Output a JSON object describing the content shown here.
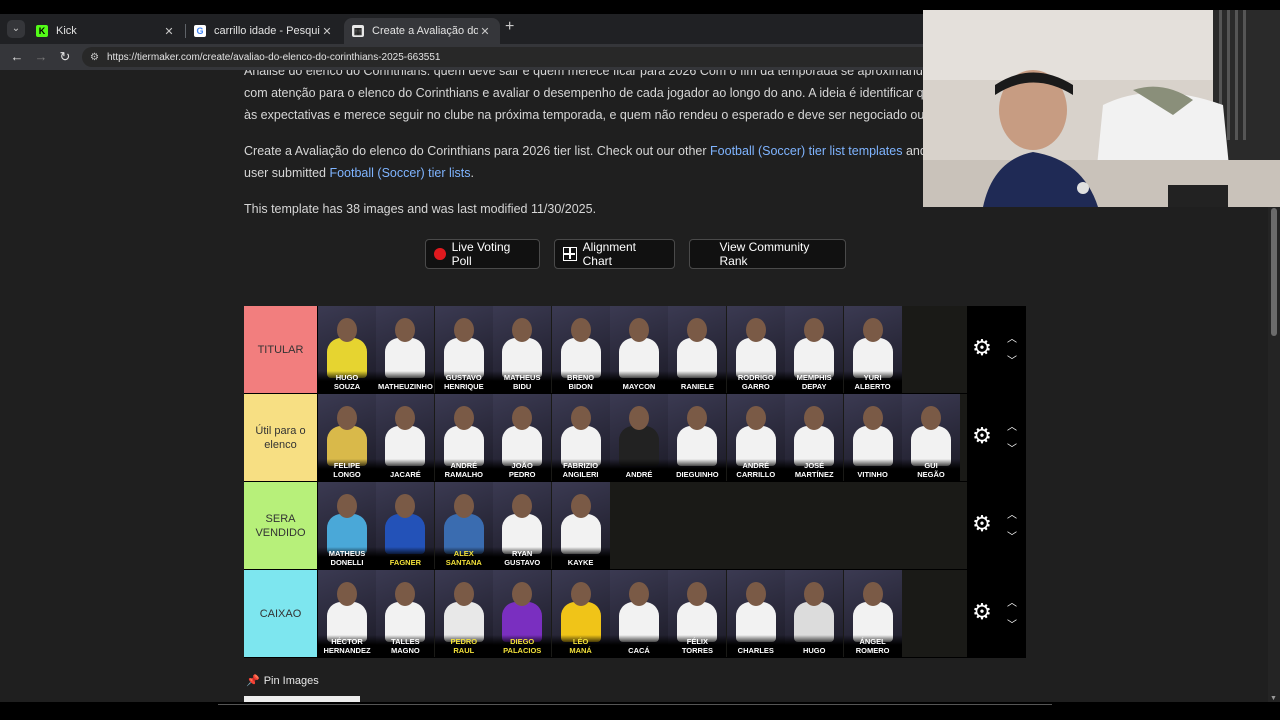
{
  "browser": {
    "tabs": [
      {
        "title": "Kick",
        "favicon": "kick-icon",
        "favicon_color": "#53fc18",
        "active": false
      },
      {
        "title": "carrillo idade - Pesquisa Google",
        "favicon": "google-icon",
        "favicon_color": "#4285f4",
        "active": false
      },
      {
        "title": "Create a Avaliação do elenco do...",
        "favicon": "tiermaker-icon",
        "favicon_color": "#e8e8e8",
        "active": true
      }
    ],
    "url": "https://tiermaker.com/create/avaliao-do-elenco-do-corinthians-2025-663551"
  },
  "page": {
    "intro_line1": "Análise do elenco do Corinthians: quem deve sair e quem merece ficar para 2026 Com o fim da temporada se aproximando",
    "intro_line2": "com atenção para o elenco do Corinthians e avaliar o desempenho de cada jogador ao longo do ano. A ideia é identificar qu",
    "intro_line3": "às expectativas e merece seguir no clube na próxima temporada, e quem não rendeu o esperado e deve ser negociado ou",
    "create_prefix": "Create a Avaliação do elenco do Corinthians para 2026 tier list. Check out our other ",
    "create_link1": "Football (Soccer) tier list templates",
    "create_mid": " and",
    "create_prefix2": "user submitted ",
    "create_link2": "Football (Soccer) tier lists",
    "create_suffix": ".",
    "template_info": "This template has 38 images and was last modified 11/30/2025.",
    "buttons": {
      "live_voting": "Live Voting Poll",
      "alignment": "Alignment Chart",
      "community_rank": "View Community Rank"
    },
    "pin_images": "Pin Images"
  },
  "tiers": [
    {
      "label": "TITULAR",
      "color": "#f27e7e",
      "players": [
        {
          "name": "HUGO\nSOUZA",
          "yellow": false,
          "kit": "#e6d430"
        },
        {
          "name": "MATHEUZINHO",
          "yellow": false,
          "kit": "#f2f2f2"
        },
        {
          "name": "GUSTAVO\nHENRIQUE",
          "yellow": false,
          "kit": "#f2f2f2"
        },
        {
          "name": "MATHEUS\nBIDU",
          "yellow": false,
          "kit": "#f2f2f2"
        },
        {
          "name": "BRENO\nBIDON",
          "yellow": false,
          "kit": "#f2f2f2"
        },
        {
          "name": "MAYCON",
          "yellow": false,
          "kit": "#f2f2f2"
        },
        {
          "name": "RANIELE",
          "yellow": false,
          "kit": "#f2f2f2"
        },
        {
          "name": "RODRIGO\nGARRO",
          "yellow": false,
          "kit": "#f2f2f2"
        },
        {
          "name": "MEMPHIS\nDEPAY",
          "yellow": false,
          "kit": "#f2f2f2"
        },
        {
          "name": "YURI\nALBERTO",
          "yellow": false,
          "kit": "#f2f2f2"
        }
      ]
    },
    {
      "label": "Útil para o elenco",
      "color": "#f7df83",
      "players": [
        {
          "name": "FELIPE\nLONGO",
          "yellow": false,
          "kit": "#d9b94a"
        },
        {
          "name": "JACARÉ",
          "yellow": false,
          "kit": "#f2f2f2"
        },
        {
          "name": "ANDRÉ\nRAMALHO",
          "yellow": false,
          "kit": "#f2f2f2"
        },
        {
          "name": "JOÃO\nPEDRO",
          "yellow": false,
          "kit": "#f2f2f2"
        },
        {
          "name": "FABRIZIO\nANGILERI",
          "yellow": false,
          "kit": "#f2f2f2"
        },
        {
          "name": "ANDRÉ",
          "yellow": false,
          "kit": "#222222"
        },
        {
          "name": "DIEGUINHO",
          "yellow": false,
          "kit": "#f2f2f2"
        },
        {
          "name": "ANDRÉ\nCARRILLO",
          "yellow": false,
          "kit": "#f2f2f2"
        },
        {
          "name": "JOSÉ\nMARTÍNEZ",
          "yellow": false,
          "kit": "#f2f2f2"
        },
        {
          "name": "VITINHO",
          "yellow": false,
          "kit": "#f2f2f2"
        },
        {
          "name": "GUI\nNEGÃO",
          "yellow": false,
          "kit": "#f2f2f2"
        }
      ]
    },
    {
      "label": "SERA VENDIDO",
      "color": "#b7f07a",
      "players": [
        {
          "name": "MATHEUS\nDONELLI",
          "yellow": false,
          "kit": "#4aa8d8"
        },
        {
          "name": "FAGNER",
          "yellow": true,
          "kit": "#2352b8"
        },
        {
          "name": "ALEX\nSANTANA",
          "yellow": true,
          "kit": "#3a6cb0"
        },
        {
          "name": "RYAN\nGUSTAVO",
          "yellow": false,
          "kit": "#f2f2f2"
        },
        {
          "name": "KAYKE",
          "yellow": false,
          "kit": "#f2f2f2"
        }
      ]
    },
    {
      "label": "CAIXAO",
      "color": "#7de6ef",
      "players": [
        {
          "name": "HÉCTOR\nHERNANDEZ",
          "yellow": false,
          "kit": "#f2f2f2"
        },
        {
          "name": "TALLES\nMAGNO",
          "yellow": false,
          "kit": "#f2f2f2"
        },
        {
          "name": "PEDRO\nRAUL",
          "yellow": true,
          "kit": "#e8e8e8"
        },
        {
          "name": "DIEGO\nPALACIOS",
          "yellow": true,
          "kit": "#7a2fc0"
        },
        {
          "name": "LÉO\nMANÁ",
          "yellow": true,
          "kit": "#f0c418"
        },
        {
          "name": "CACÁ",
          "yellow": false,
          "kit": "#f2f2f2"
        },
        {
          "name": "FÉLIX\nTORRES",
          "yellow": false,
          "kit": "#f2f2f2"
        },
        {
          "name": "CHARLES",
          "yellow": false,
          "kit": "#f2f2f2"
        },
        {
          "name": "HUGO",
          "yellow": false,
          "kit": "#dcdcdc"
        },
        {
          "name": "ÁNGEL\nROMERO",
          "yellow": false,
          "kit": "#f2f2f2"
        }
      ]
    }
  ],
  "webcam": {
    "description_icon": "webcam-overlay"
  }
}
